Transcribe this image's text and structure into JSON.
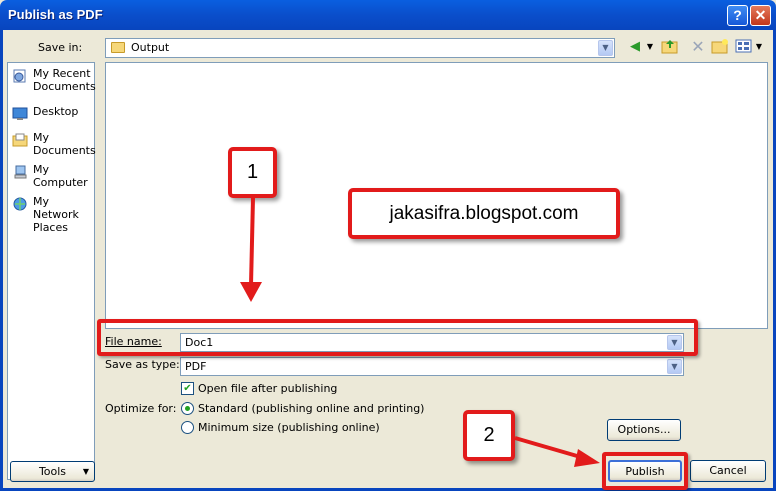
{
  "window": {
    "title": "Publish as PDF",
    "help_label": "?",
    "close_label": "✕"
  },
  "save_in": {
    "label": "Save in:",
    "value": "Output"
  },
  "places": [
    {
      "label": "My Recent Documents",
      "icon": "recent-documents-icon"
    },
    {
      "label": "Desktop",
      "icon": "desktop-icon"
    },
    {
      "label": "My Documents",
      "icon": "my-documents-icon"
    },
    {
      "label": "My Computer",
      "icon": "my-computer-icon"
    },
    {
      "label": "My Network Places",
      "icon": "network-places-icon"
    }
  ],
  "file_name": {
    "label": "File name:",
    "value": "Doc1"
  },
  "save_as_type": {
    "label": "Save as type:",
    "value": "PDF"
  },
  "open_after": {
    "label": "Open file after publishing",
    "checked": true
  },
  "optimize": {
    "label": "Optimize for:",
    "options": [
      {
        "label": "Standard (publishing online and printing)",
        "selected": true
      },
      {
        "label": "Minimum size (publishing online)",
        "selected": false
      }
    ]
  },
  "buttons": {
    "options": "Options...",
    "tools": "Tools",
    "publish": "Publish",
    "cancel": "Cancel"
  },
  "annotations": {
    "step1": "1",
    "step2": "2",
    "watermark": "jakasifra.blogspot.com",
    "accent": "#e21b1b"
  }
}
